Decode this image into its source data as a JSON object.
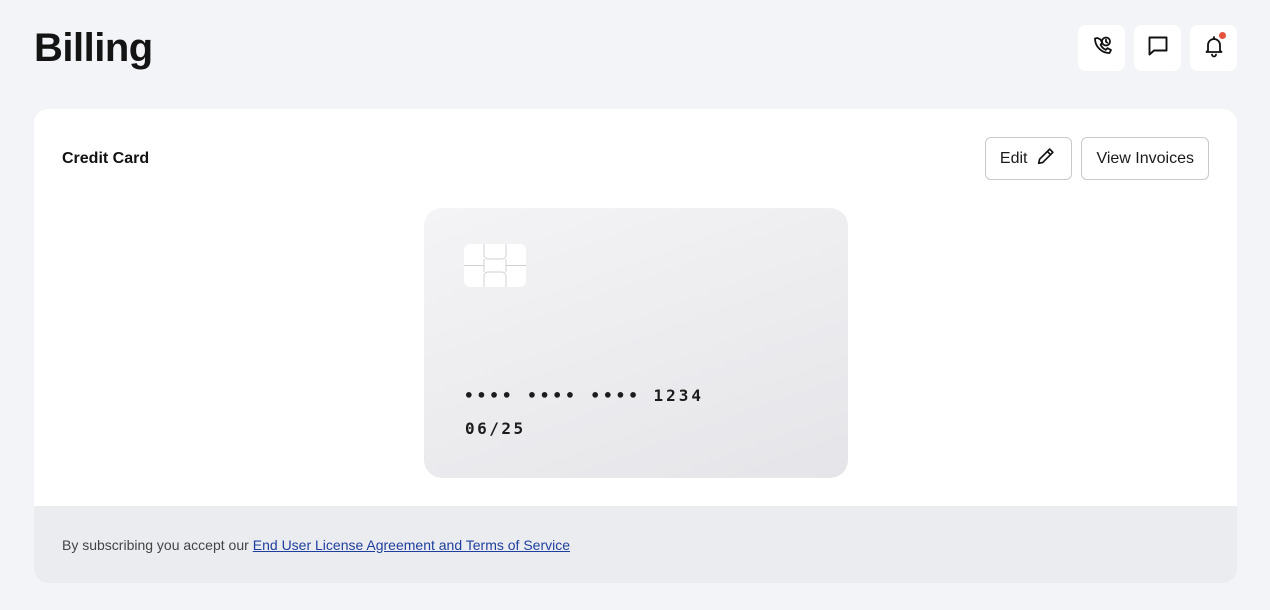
{
  "page": {
    "title": "Billing"
  },
  "header": {
    "icons": [
      "phone-clock-icon",
      "chat-icon",
      "bell-icon"
    ],
    "notification_dot_color": "#e5533d"
  },
  "credit_card_section": {
    "title": "Credit Card",
    "edit_label": "Edit",
    "view_invoices_label": "View Invoices",
    "card": {
      "number_masked": "•••• •••• •••• 1234",
      "expiry": "06/25"
    }
  },
  "footer": {
    "text": "By subscribing you accept our",
    "link_text": "End User License Agreement and Terms of Service",
    "link_color": "#1f3f9e"
  }
}
